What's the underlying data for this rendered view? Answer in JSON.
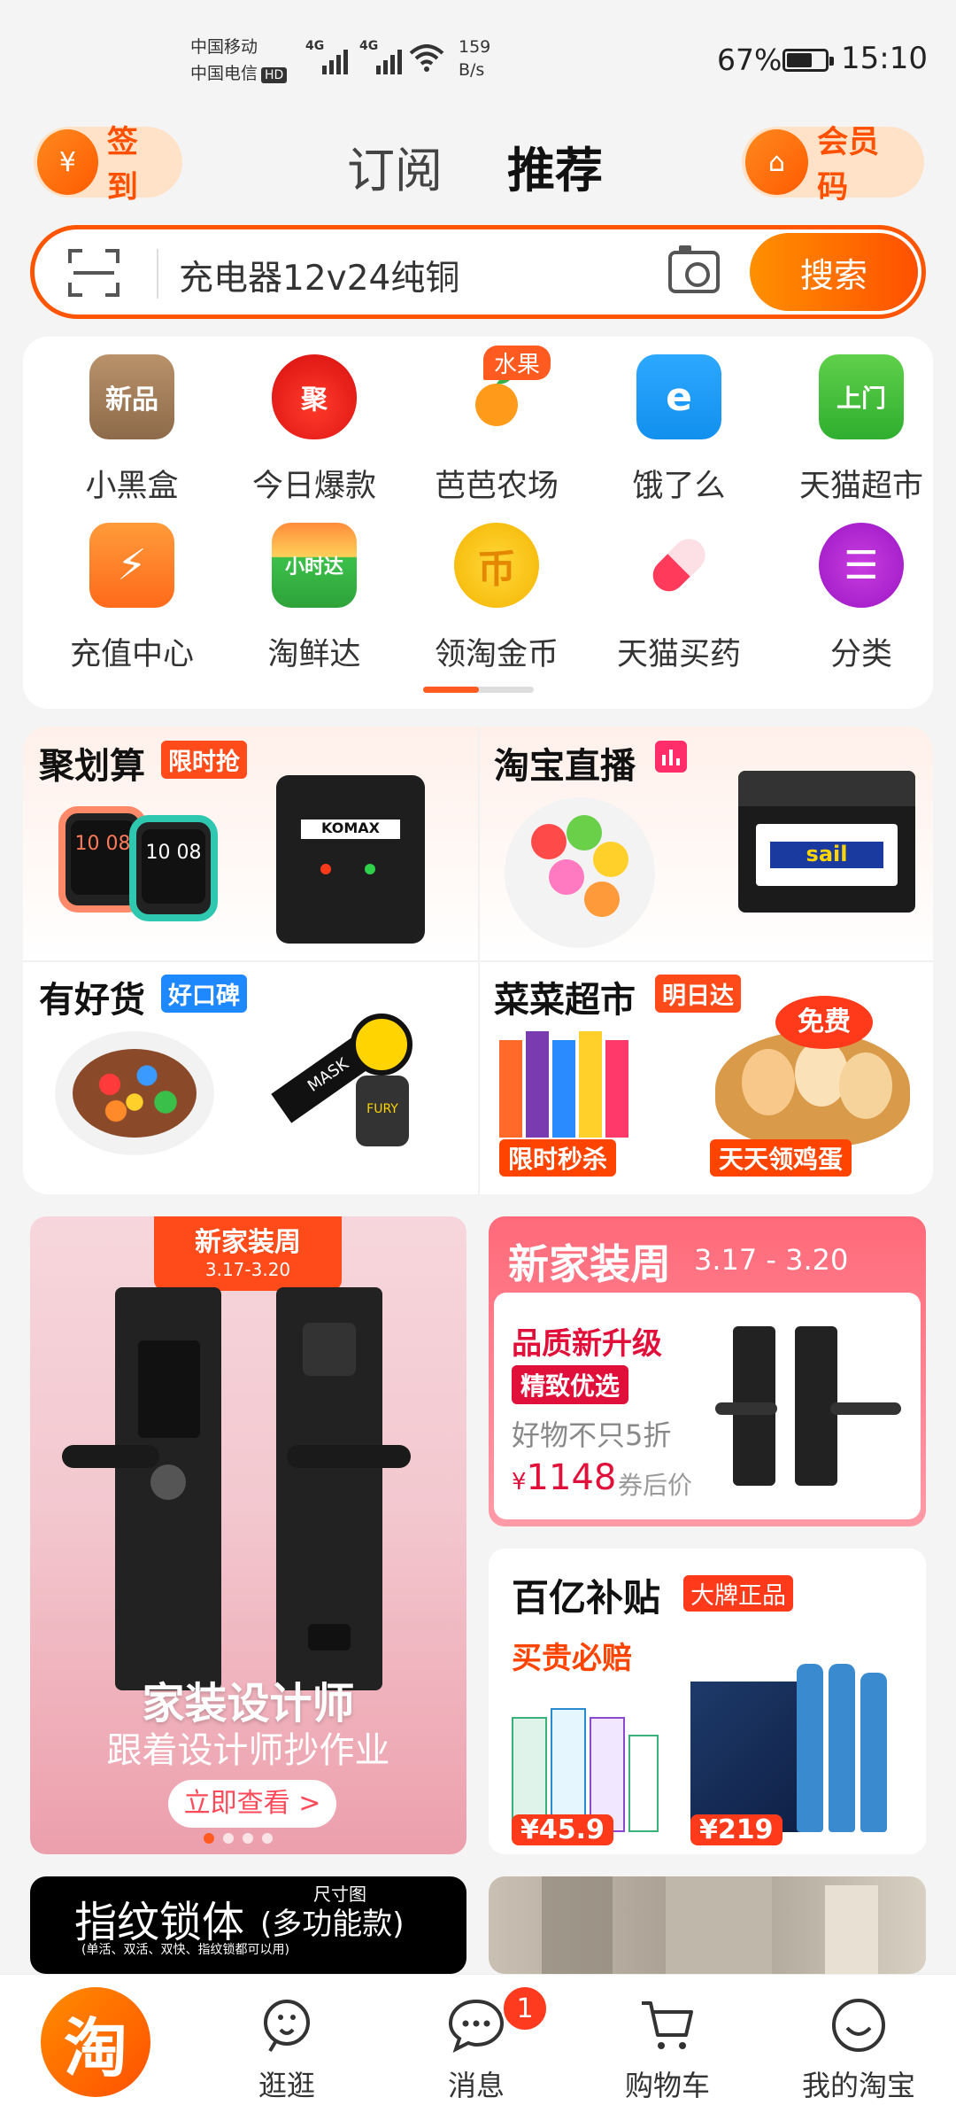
{
  "status_bar": {
    "carrier1": "中国移动",
    "carrier2": "中国电信",
    "hd": "HD",
    "sig1": "4G",
    "sig2": "4G",
    "net_speed": "159",
    "net_unit": "B/s",
    "battery_pct": "67%",
    "battery_level": 0.67,
    "time": "15:10"
  },
  "header": {
    "checkin_label": "签到",
    "tab_subscribe": "订阅",
    "tab_recommend": "推荐",
    "member_code_label": "会员码"
  },
  "search": {
    "query": "充电器12v24纯铜",
    "button": "搜索"
  },
  "grid": {
    "badge": "水果",
    "items": [
      {
        "label": "小黑盒",
        "icon_text": "新品"
      },
      {
        "label": "今日爆款",
        "icon_text": "聚"
      },
      {
        "label": "芭芭农场",
        "icon_text": ""
      },
      {
        "label": "饿了么",
        "icon_text": "e"
      },
      {
        "label": "天猫超市",
        "icon_text": "上门"
      },
      {
        "label": "充值中心",
        "icon_text": "⚡"
      },
      {
        "label": "淘鲜达",
        "icon_text": "小时达"
      },
      {
        "label": "领淘金币",
        "icon_text": "币"
      },
      {
        "label": "天猫买药",
        "icon_text": ""
      },
      {
        "label": "分类",
        "icon_text": "☰"
      }
    ],
    "page_progress": 0.5
  },
  "promo": {
    "juhuasuan": {
      "title": "聚划算",
      "tag": "限时抢"
    },
    "live": {
      "title": "淘宝直播"
    },
    "youhaohuo": {
      "title": "有好货",
      "tag": "好口碑"
    },
    "caicai": {
      "title": "菜菜超市",
      "tag": "明日达",
      "prod1_tag": "限时秒杀",
      "prod2_tag": "天天领鸡蛋",
      "free_badge": "免费"
    },
    "brand_labels": {
      "komax": "KOMAX",
      "sail": "sail",
      "mask": "MASK",
      "fury": "FURY"
    },
    "watch_digits": {
      "w1": "10 08",
      "w2": "10 08"
    }
  },
  "feed": {
    "card1": {
      "banner": "新家装周",
      "dates": "3.17-3.20",
      "title": "家装设计师",
      "subtitle": "跟着设计师抄作业",
      "cta": "立即查看 >"
    },
    "card2": {
      "banner": "新家装周",
      "dates": "3.17 - 3.20",
      "headline": "品质新升级",
      "tag": "精致优选",
      "desc": "好物不只5折",
      "currency": "¥",
      "price": "1148",
      "price_suffix": "券后价"
    },
    "card3": {
      "title": "百亿补贴",
      "tag": "大牌正品",
      "slogan": "买贵必赔",
      "price1": "¥45.9",
      "price2": "¥219"
    },
    "card4": {
      "title": "指纹锁体",
      "subtitle": "(多功能款)",
      "size_label": "尺寸图",
      "note": "(单活、双活、双快、指纹锁都可以用)"
    }
  },
  "bottom_nav": {
    "home_char": "淘",
    "items": [
      "逛逛",
      "消息",
      "购物车",
      "我的淘宝"
    ],
    "message_badge": "1"
  },
  "colors": {
    "brand": "#ff5000",
    "accent": "#ff9000"
  }
}
